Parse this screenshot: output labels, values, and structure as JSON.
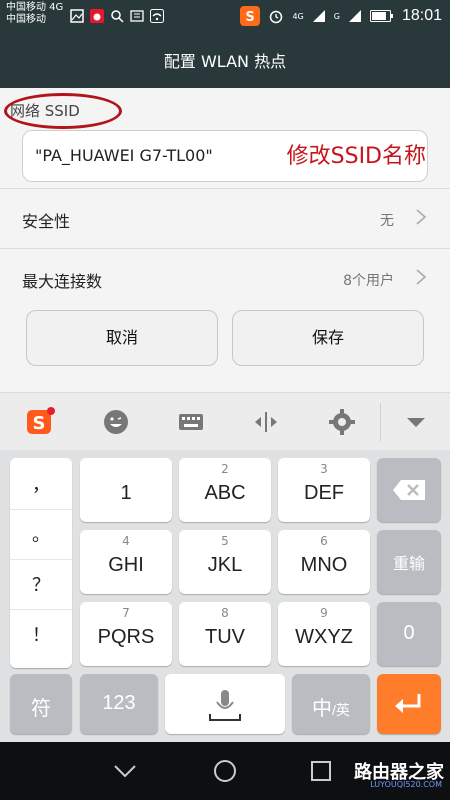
{
  "status_bar": {
    "carrier_line1": "中国移动 4G",
    "carrier_line2": "中国移动",
    "network_1": "4G",
    "network_2": "G",
    "time": "18:01"
  },
  "title": "配置 WLAN 热点",
  "ssid": {
    "label": "网络 SSID",
    "value": "\"PA_HUAWEI G7-TL00\"",
    "annotation": "修改SSID名称"
  },
  "settings": [
    {
      "label": "安全性",
      "value": "无"
    },
    {
      "label": "最大连接数",
      "value": "8个用户"
    }
  ],
  "buttons": {
    "cancel": "取消",
    "save": "保存"
  },
  "ime_toolbar": {
    "icons": [
      "sogou-logo-icon",
      "emoji-icon",
      "keyboard-icon",
      "cursor-move-icon",
      "gear-icon",
      "collapse-icon"
    ],
    "accent_dot": "#e5202e"
  },
  "keyboard": {
    "punctuation": [
      "，",
      "。",
      "？",
      "！"
    ],
    "rows": [
      [
        {
          "sub": "",
          "main": "1"
        },
        {
          "sub": "2",
          "main": "ABC"
        },
        {
          "sub": "3",
          "main": "DEF"
        }
      ],
      [
        {
          "sub": "4",
          "main": "GHI"
        },
        {
          "sub": "5",
          "main": "JKL"
        },
        {
          "sub": "6",
          "main": "MNO"
        }
      ],
      [
        {
          "sub": "7",
          "main": "PQRS"
        },
        {
          "sub": "8",
          "main": "TUV"
        },
        {
          "sub": "9",
          "main": "WXYZ"
        }
      ]
    ],
    "backspace_icon": "backspace-icon",
    "reinput": "重输",
    "zero": "0",
    "symbol": "符",
    "num123": "123",
    "mic_icon": "microphone-icon",
    "lang_main": "中",
    "lang_sub": "/英",
    "enter_icon": "enter-icon",
    "enter_color": "#ff7d2a"
  },
  "nav_bar": {
    "icons": [
      "back-icon",
      "home-icon",
      "recents-icon"
    ]
  },
  "watermark": {
    "text": "路由器之家",
    "url": "LUYOUQI520.COM"
  },
  "colors": {
    "header": "#29393b",
    "ssid_highlight": "#b2141b",
    "annotation": "#c8141b"
  }
}
